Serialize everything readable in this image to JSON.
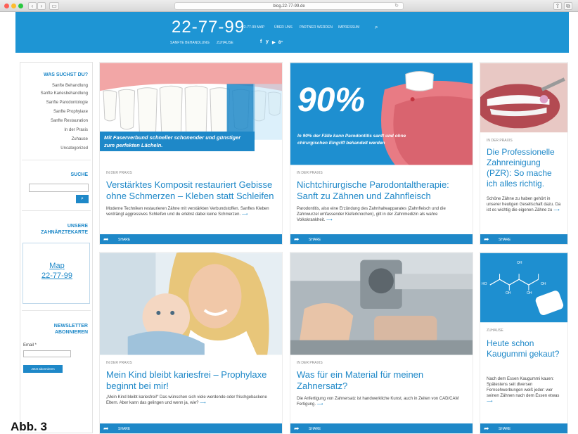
{
  "browser": {
    "address": "blog.22-77-99.de",
    "back_glyph": "‹",
    "forward_glyph": "›",
    "sidebar_glyph": "▭",
    "reload_glyph": "↻",
    "share_glyph": "⇪",
    "tabs_glyph": "⧉",
    "traffic_lights": [
      "#fd5f57",
      "#febc2e",
      "#28c840"
    ]
  },
  "header": {
    "logo": "22-77-99",
    "nav_top": [
      "22-77-99 MAP",
      "ÜBER UNS",
      "PARTNER WERDEN",
      "IMPRESSUM"
    ],
    "nav_bottom": [
      "SANFTE BEHANDLUNG",
      "ZUHAUSE"
    ],
    "social": [
      "f",
      "y",
      "▶",
      "8⁺"
    ],
    "search_glyph": "⌕",
    "bg_color": "#1e95d4"
  },
  "sidebar": {
    "search_heading": "WAS SUCHST DU?",
    "categories": [
      "Sanfte Behandlung",
      "Sanfte Kariesbehandlung",
      "Sanfte Parodontologie",
      "Sanfte Prophylaxe",
      "Sanfte Restauration",
      "In der Praxis",
      "Zuhause",
      "Uncategorized"
    ],
    "suche_heading": "SUCHE",
    "search_placeholder": "",
    "search_button_glyph": "⌕",
    "map_heading_1": "UNSERE",
    "map_heading_2": "ZAHNÄRZTEKARTE",
    "map_line_1": "Map",
    "map_line_2": "22-77-99",
    "newsletter_1": "NEWSLETTER",
    "newsletter_2": "ABONNIEREN",
    "email_label": "Email *",
    "subscribe_label": "Jetzt abonnieren"
  },
  "cards": [
    {
      "category": "IN DER PRAXIS",
      "title": "Verstärktes Komposit restauriert Gebisse ohne Schmerzen – Kleben statt Schleifen",
      "excerpt": "Moderne Techniken restaurieren Zähne mit verstärkten Verbundstoffen. Sanftes Kleben verdrängt aggressives Schleifen und du erlebst dabei keine Schmerzen.",
      "overlay": "Mit Faserverbund schneller schonender und günstiger zum perfekten Lächeln.",
      "share": "SHARE"
    },
    {
      "category": "IN DER PRAXIS",
      "title": "Nichtchirurgische Parodontaltherapie: Sanft zu Zähnen und Zahnfleisch",
      "excerpt": "Parodontitis, also eine Erzündung des Zahnhalteapparates (Zahnfleisch und die Zahnwurzel umfassender Kieferknochen), gilt in der Zahnmedizin als wahre Volkskrankheit.",
      "big_number": "90%",
      "overlay": "In 90% der Fälle kann Parodontitis sanft und ohne chirurgischen Eingriff behandelt werden",
      "share": "SHARE"
    },
    {
      "category": "IN DER PRAXIS",
      "title": "Die Professionelle Zahnreinigung (PZR): So mache ich alles richtig.",
      "excerpt": "Schöne Zähne zu haben gehört in unserer heutigen Gesellschaft dazu. Da ist es wichtig die eigenen Zähne zu",
      "share": "SHARE"
    },
    {
      "category": "IN DER PRAXIS",
      "title": "Mein Kind bleibt kariesfrei – Prophylaxe beginnt bei mir!",
      "excerpt": "„Mein Kind bleibt kariesfrei!“ Das wünschen sich viele werdende oder frischgebackene Eltern. Aber kann das gelingen und wenn ja, wie?",
      "share": "SHARE"
    },
    {
      "category": "IN DER PRAXIS",
      "title": "Was für ein Material für meinen Zahnersatz?",
      "excerpt": "Die Anfertigung von Zahnersatz ist handwerkliche Kunst, auch in Zeiten von CAD/CAM Fertigung.",
      "share": "SHARE"
    },
    {
      "category": "ZUHAUSE",
      "title": "Heute schon Kaugummi gekaut?",
      "excerpt": "Nach dem Essen Kaugummi kauen: Spätestens seit diversen Fernsehwerbungen weiß jeder: wer seinen Zähnen nach dem Essen etwas",
      "molecule_labels": [
        "OH",
        "HO",
        "OH",
        "OH",
        "OH"
      ],
      "share": "SHARE"
    }
  ],
  "figure_label": "Abb. 3",
  "arrow_glyph": "⟶",
  "share_glyph": "➦",
  "colors": {
    "accent": "#1e88c8",
    "header": "#1e95d4"
  }
}
